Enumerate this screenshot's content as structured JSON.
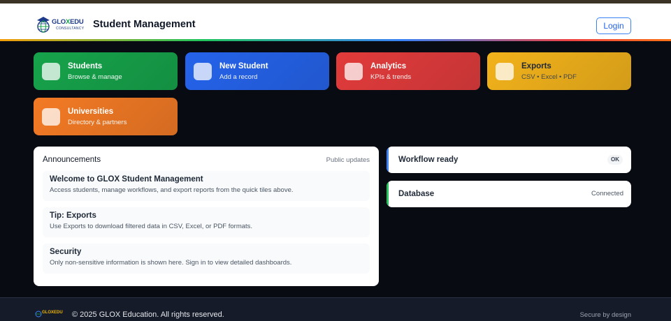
{
  "header": {
    "brand_main": "GLOXEDU",
    "brand_sub": "CONSULTANCY",
    "app_title": "Student Management",
    "login_label": "Login"
  },
  "tiles": [
    {
      "title": "Students",
      "subtitle": "Browse & manage",
      "color": "#16a34a"
    },
    {
      "title": "New Student",
      "subtitle": "Add a record",
      "color": "#2563eb"
    },
    {
      "title": "Analytics",
      "subtitle": "KPIs & trends",
      "color": "#e23b3b"
    },
    {
      "title": "Exports",
      "subtitle": "CSV • Excel • PDF",
      "color": "#f2b21a"
    },
    {
      "title": "Universities",
      "subtitle": "Directory & partners",
      "color": "#f37a24"
    }
  ],
  "announcements": {
    "title": "Announcements",
    "meta": "Public updates",
    "items": [
      {
        "title": "Welcome to GLOX Student Management",
        "body": "Access students, manage workflows, and export reports from the quick tiles above."
      },
      {
        "title": "Tip: Exports",
        "body": "Use Exports to download filtered data in CSV, Excel, or PDF formats."
      },
      {
        "title": "Security",
        "body": "Only non-sensitive information is shown here. Sign in to view detailed dashboards."
      }
    ]
  },
  "status": {
    "workflow": {
      "title": "Workflow ready",
      "badge": "OK",
      "color": "#3b82f6"
    },
    "database": {
      "title": "Database",
      "value": "Connected",
      "color": "#22c55e"
    }
  },
  "footer": {
    "logo_text": "GLOXEDU",
    "copyright": "© 2025 GLOX Education. All rights reserved.",
    "secure": "Secure by design"
  }
}
